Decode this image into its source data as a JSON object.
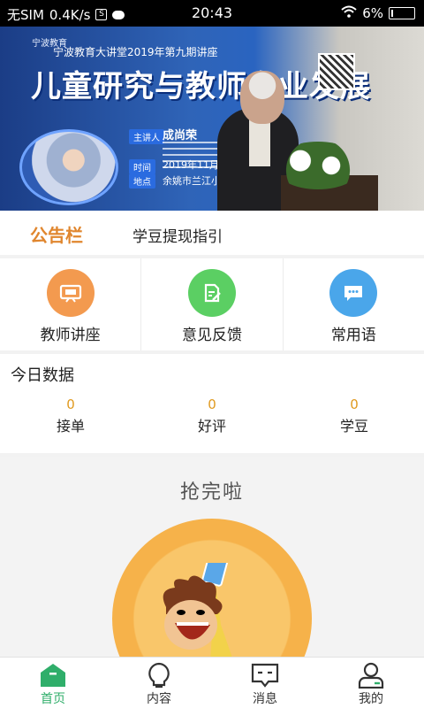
{
  "status_bar": {
    "carrier": "无SIM",
    "speed": "0.4K/s",
    "time": "20:43",
    "battery": "6%"
  },
  "banner": {
    "org": "宁波教育",
    "topline": "宁波教育大讲堂2019年第九期讲座",
    "title": "儿童研究与教师专业发展",
    "speaker_label": "主讲人",
    "speaker_name": "成尚荣",
    "date_label": "时间",
    "date": "2019年11月16日（周六）",
    "place_label": "地点",
    "place": "余姚市兰江小学四楼报告厅"
  },
  "notice": {
    "tag": "公告栏",
    "text": "学豆提现指引"
  },
  "quick_actions": [
    {
      "label": "教师讲座",
      "color": "#f39a4f",
      "icon": "tv-icon"
    },
    {
      "label": "意见反馈",
      "color": "#5bcf63",
      "icon": "edit-icon"
    },
    {
      "label": "常用语",
      "color": "#4aa6ea",
      "icon": "chat-icon"
    }
  ],
  "today": {
    "title": "今日数据",
    "stats": [
      {
        "label": "接单",
        "value": "0"
      },
      {
        "label": "好评",
        "value": "0"
      },
      {
        "label": "学豆",
        "value": "0"
      }
    ]
  },
  "empty_state": {
    "message": "抢完啦"
  },
  "tabbar": {
    "tabs": [
      {
        "label": "首页",
        "icon": "home-icon",
        "active": true
      },
      {
        "label": "内容",
        "icon": "bulb-icon",
        "active": false
      },
      {
        "label": "消息",
        "icon": "message-icon",
        "active": false
      },
      {
        "label": "我的",
        "icon": "profile-icon",
        "active": false
      }
    ],
    "accent": "#2fae6a"
  }
}
